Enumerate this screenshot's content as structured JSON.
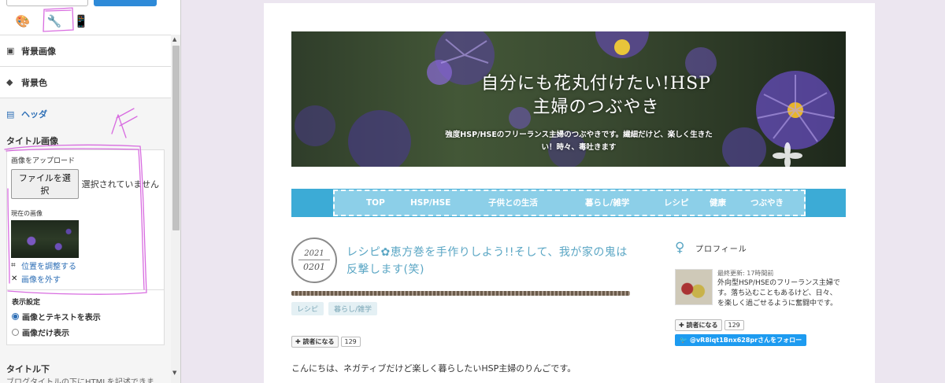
{
  "panel": {
    "tabs": [
      {
        "name": "design",
        "icon": "palette-icon",
        "glyph": "🎨"
      },
      {
        "name": "customize",
        "icon": "wrench-icon",
        "glyph": "🔧"
      },
      {
        "name": "smartphone",
        "icon": "smartphone-icon",
        "glyph": "📱"
      }
    ],
    "accordion": {
      "background_image": "背景画像",
      "background_color": "背景色",
      "header": "ヘッダ"
    },
    "title_image": {
      "section_title": "タイトル画像",
      "upload_label": "画像をアップロード",
      "file_button": "ファイルを選択",
      "file_status": "選択されていません",
      "current_label": "現在の画像",
      "adjust_link": "位置を調整する",
      "remove_link": "画像を外す"
    },
    "display": {
      "label": "表示設定",
      "options": [
        "画像とテキストを表示",
        "画像だけ表示"
      ],
      "selected": 0
    },
    "below_title": {
      "title": "タイトル下",
      "desc": "ブログタイトルの下にHTMLを記述できます。ナビゲーションメニューなどにお使いい"
    }
  },
  "blog": {
    "title_line1": "自分にも花丸付けたい!HSP",
    "title_line2": "主婦のつぶやき",
    "description": "強度HSP/HSEのフリーランス主婦のつぶやきです。繊細だけど、楽しく生きたい！時々、毒吐きます",
    "nav": [
      "TOP",
      "HSP/HSE",
      "子供との生活",
      "暮らし/雑学",
      "レシピ",
      "健康",
      "つぶやき"
    ],
    "post": {
      "date_year": "2021",
      "date_md": "0201",
      "title": "レシピ✿恵方巻を手作りしよう!!そして、我が家の鬼は反撃します(笑)",
      "tags": [
        "レシピ",
        "暮らし/雑学"
      ],
      "reader_button": "読者になる",
      "reader_count": "129",
      "body_first_line": "こんにちは、ネガティブだけど楽しく暮らしたいHSP主婦のりんごです。"
    },
    "sidebar": {
      "profile_label": "プロフィール",
      "last_updated": "最終更新: 17時間前",
      "profile_text": "外向型HSP/HSEのフリーランス主婦です。落ち込むこともあるけど、日々、を楽しく過ごせるように奮闘中です。",
      "reader_button": "読者になる",
      "reader_count": "129",
      "twitter_button": "@vR8iqt1Bnx628prさんをフォロー"
    }
  },
  "colors": {
    "nav_bg": "#3cabd6",
    "nav_inner": "#8ccfe8",
    "link_blue": "#2e6fb6",
    "post_title": "#5aa6c4",
    "annotation": "#d86ce0"
  }
}
